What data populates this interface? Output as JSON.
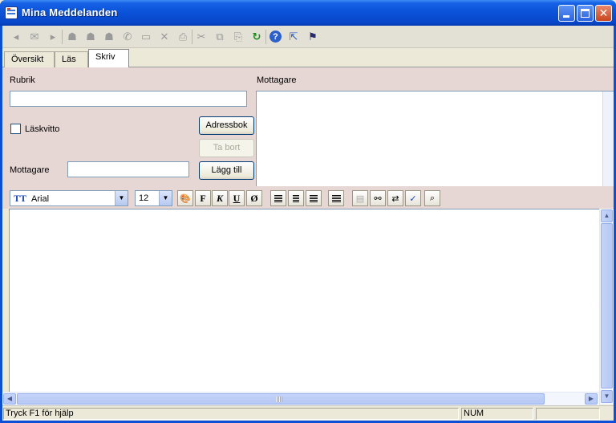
{
  "window": {
    "title": "Mina Meddelanden",
    "caption": {
      "minimize": "",
      "maximize": "",
      "close": "✕"
    }
  },
  "toolbar": {
    "items": [
      {
        "name": "back-icon",
        "glyph": "◂"
      },
      {
        "name": "reply-icon",
        "glyph": "✉"
      },
      {
        "name": "forward-icon",
        "glyph": "▸"
      },
      {
        "name": "reply-all-icon",
        "glyph": "☗"
      },
      {
        "name": "reply-sender-icon",
        "glyph": "☗"
      },
      {
        "name": "forward-mail-icon",
        "glyph": "☗"
      },
      {
        "name": "mark-read-icon",
        "glyph": "✆"
      },
      {
        "name": "move-icon",
        "glyph": "▭"
      },
      {
        "name": "delete-icon",
        "glyph": "✕"
      },
      {
        "name": "print-icon",
        "glyph": "⎙"
      },
      {
        "name": "cut-icon",
        "glyph": "✂"
      },
      {
        "name": "copy-icon",
        "glyph": "⧉"
      },
      {
        "name": "paste-icon",
        "glyph": "⎘"
      },
      {
        "name": "refresh-icon",
        "glyph": "↻"
      },
      {
        "name": "help-icon",
        "glyph": "?"
      },
      {
        "name": "context-help-icon",
        "glyph": "⇱"
      },
      {
        "name": "send-icon",
        "glyph": "⚑"
      }
    ]
  },
  "tabs": [
    {
      "label": "Översikt"
    },
    {
      "label": "Läs"
    },
    {
      "label": "Skriv"
    }
  ],
  "compose": {
    "subject_label": "Rubrik",
    "subject_value": "",
    "recipients_label": "Mottagare",
    "read_receipt_label": "Läskvitto",
    "read_receipt_checked": false,
    "addressbook_button": "Adressbok",
    "remove_button": "Ta bort",
    "recipient_input_label": "Mottagare",
    "recipient_input_value": "",
    "add_button": "Lägg till"
  },
  "format": {
    "font": "Arial",
    "size": "12",
    "font_icon": "TT",
    "bold": "F",
    "italic": "K",
    "underline": "U",
    "strikethrough": "Ø",
    "color_icon": "🎨"
  },
  "editor": {
    "content": ""
  },
  "status": {
    "message": "Tryck F1 för hjälp",
    "indicator": "NUM"
  },
  "colors": {
    "titlebar": "#0a51d8",
    "panel": "#e6d6d4",
    "chrome": "#ece9d8",
    "accent_green": "#1c8b1c"
  }
}
